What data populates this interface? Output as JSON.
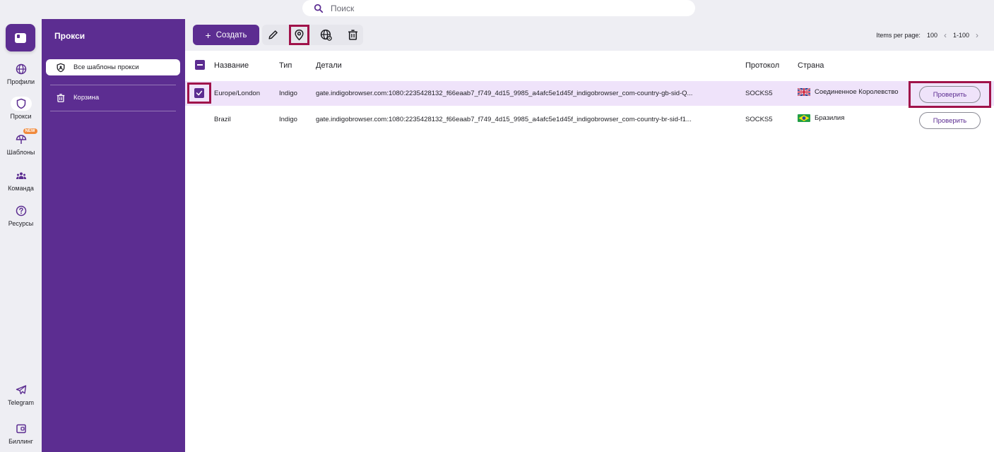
{
  "search": {
    "placeholder": "Поиск"
  },
  "rail": {
    "items": [
      {
        "label": "Профили",
        "icon": "globe-icon"
      },
      {
        "label": "Прокси",
        "icon": "shield-icon"
      },
      {
        "label": "Шаблоны",
        "icon": "umbrella-icon",
        "badge": "NEW"
      },
      {
        "label": "Команда",
        "icon": "team-icon"
      },
      {
        "label": "Ресурсы",
        "icon": "help-circle-icon"
      },
      {
        "label": "Telegram",
        "icon": "telegram-icon"
      },
      {
        "label": "Биллинг",
        "icon": "wallet-icon"
      }
    ]
  },
  "panel": {
    "title": "Прокси",
    "items": [
      {
        "label": "Все шаблоны прокси",
        "icon": "shield-user-icon"
      },
      {
        "label": "Корзина",
        "icon": "trash-icon"
      }
    ]
  },
  "toolbar": {
    "create_label": "Создать",
    "tools": [
      "edit-icon",
      "location-pin-icon",
      "globe-settings-icon",
      "trash-icon"
    ]
  },
  "pager": {
    "label": "Items per page:",
    "per_page": "100",
    "range": "1-100"
  },
  "table": {
    "columns": [
      "Название",
      "Тип",
      "Детали",
      "Протокол",
      "Страна"
    ],
    "rows": [
      {
        "name": "Europe/London",
        "type": "Indigo",
        "details": "gate.indigobrowser.com:1080:2235428132_f66eaab7_f749_4d15_9985_a4afc5e1d45f_indigobrowser_com-country-gb-sid-Q...",
        "protocol": "SOCKS5",
        "country": "Соединенное Королевство",
        "flag": "uk-flag-icon",
        "action": "Проверить",
        "selected": true
      },
      {
        "name": "Brazil",
        "type": "Indigo",
        "details": "gate.indigobrowser.com:1080:2235428132_f66eaab7_f749_4d15_9985_a4afc5e1d45f_indigobrowser_com-country-br-sid-f1...",
        "protocol": "SOCKS5",
        "country": "Бразилия",
        "flag": "brazil-flag-icon",
        "action": "Проверить",
        "selected": false
      }
    ]
  },
  "colors": {
    "brand": "#5c2d91",
    "highlight": "#a0124a",
    "selected_row": "#efe3fa"
  }
}
